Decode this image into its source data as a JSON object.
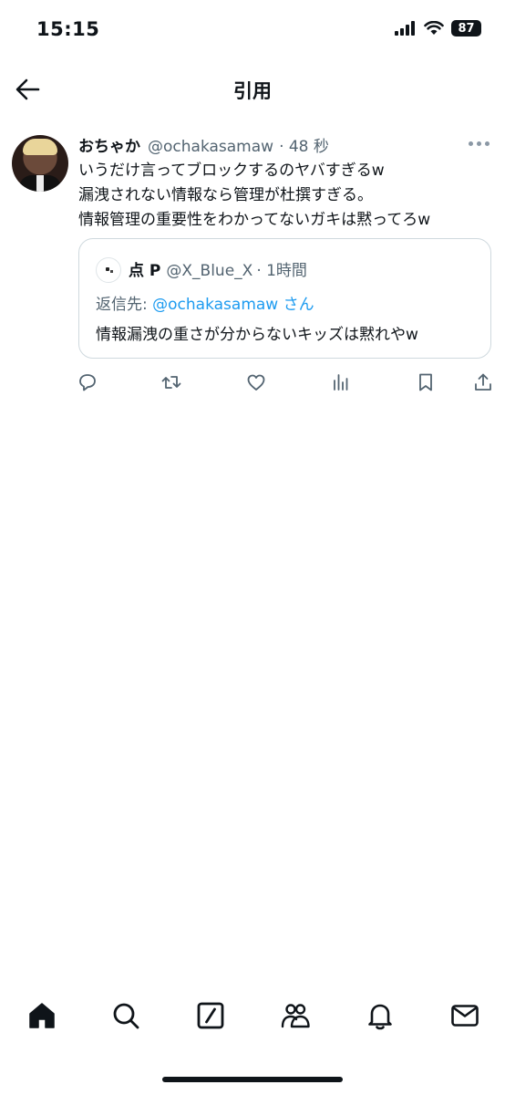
{
  "status_bar": {
    "time": "15:15",
    "battery": "87"
  },
  "header": {
    "title": "引用"
  },
  "tweet": {
    "author_name": "おちゃか",
    "author_handle": "@ochakasamaw",
    "timestamp": "· 48 秒",
    "text_lines": [
      "いうだけ言ってブロックするのヤバすぎるw",
      "漏洩されない情報なら管理が杜撰すぎる。",
      "情報管理の重要性をわかってないガキは黙ってろw"
    ]
  },
  "quoted_tweet": {
    "author_name": "点 P",
    "author_handle": "@X_Blue_X",
    "timestamp": "· 1時間",
    "reply_prefix": "返信先: ",
    "reply_mention": "@ochakasamaw",
    "reply_suffix": " さん",
    "text": "情報漏洩の重さが分からないキッズは黙れやw"
  },
  "actions": [
    "reply-icon",
    "retweet-icon",
    "like-icon",
    "views-icon",
    "bookmark-icon",
    "share-icon"
  ],
  "tab_bar": [
    "home-icon",
    "search-icon",
    "compose-icon",
    "communities-icon",
    "notifications-icon",
    "messages-icon"
  ],
  "colors": {
    "text": "#0f1419",
    "secondary": "#536471",
    "accent": "#1d9bf0",
    "border": "#cfd9de"
  }
}
